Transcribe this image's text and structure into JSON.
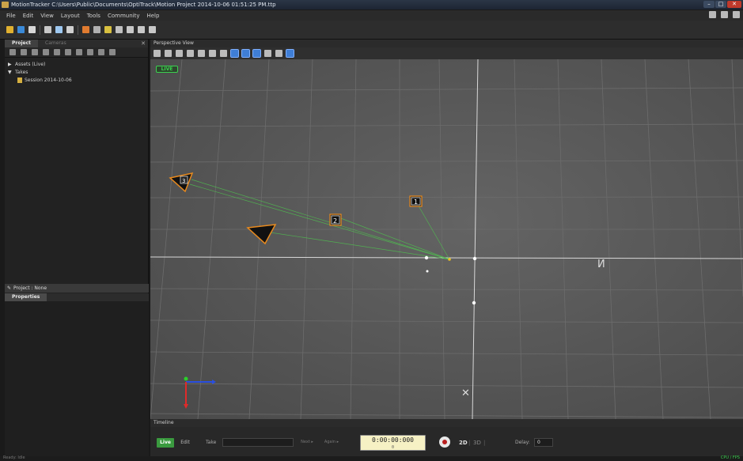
{
  "window": {
    "title": "MotionTracker  C:\\Users\\Public\\Documents\\OptiTrack\\Motion Project 2014-10-06 01:51:25 PM.ttp"
  },
  "menu": [
    "File",
    "Edit",
    "View",
    "Layout",
    "Tools",
    "Community",
    "Help"
  ],
  "left_panel": {
    "tabs": [
      "Project",
      "Cameras"
    ],
    "tree": [
      {
        "label": "Assets (Live)",
        "expanded": false
      },
      {
        "label": "Takes",
        "expanded": true
      }
    ],
    "take_item": "Session 2014-10-06"
  },
  "properties": {
    "header": "Project : None",
    "tab": "Properties"
  },
  "viewport": {
    "title": "Perspective View",
    "live_badge": "LIVE",
    "camera_labels": [
      "1",
      "2",
      "3"
    ]
  },
  "timeline": {
    "title": "Timeline",
    "live_label": "Live",
    "edit_label": "Edit",
    "take_label": "Take",
    "next_label": "Next ▸",
    "again_label": "Again ▸",
    "timecode": "0:00:00:000",
    "timecode_sub": "0",
    "mode_2d": "2D",
    "mode_3d": "3D",
    "delay_label": "Delay:",
    "delay_value": "0"
  },
  "status": {
    "left": "Ready: Idle",
    "right": "CPU / FPS"
  },
  "colors": {
    "live_green": "#3bd14f",
    "timecode_bg": "#f6f1c4",
    "camera_outline": "#e88a1e",
    "ray_green": "#4fbf4f"
  }
}
